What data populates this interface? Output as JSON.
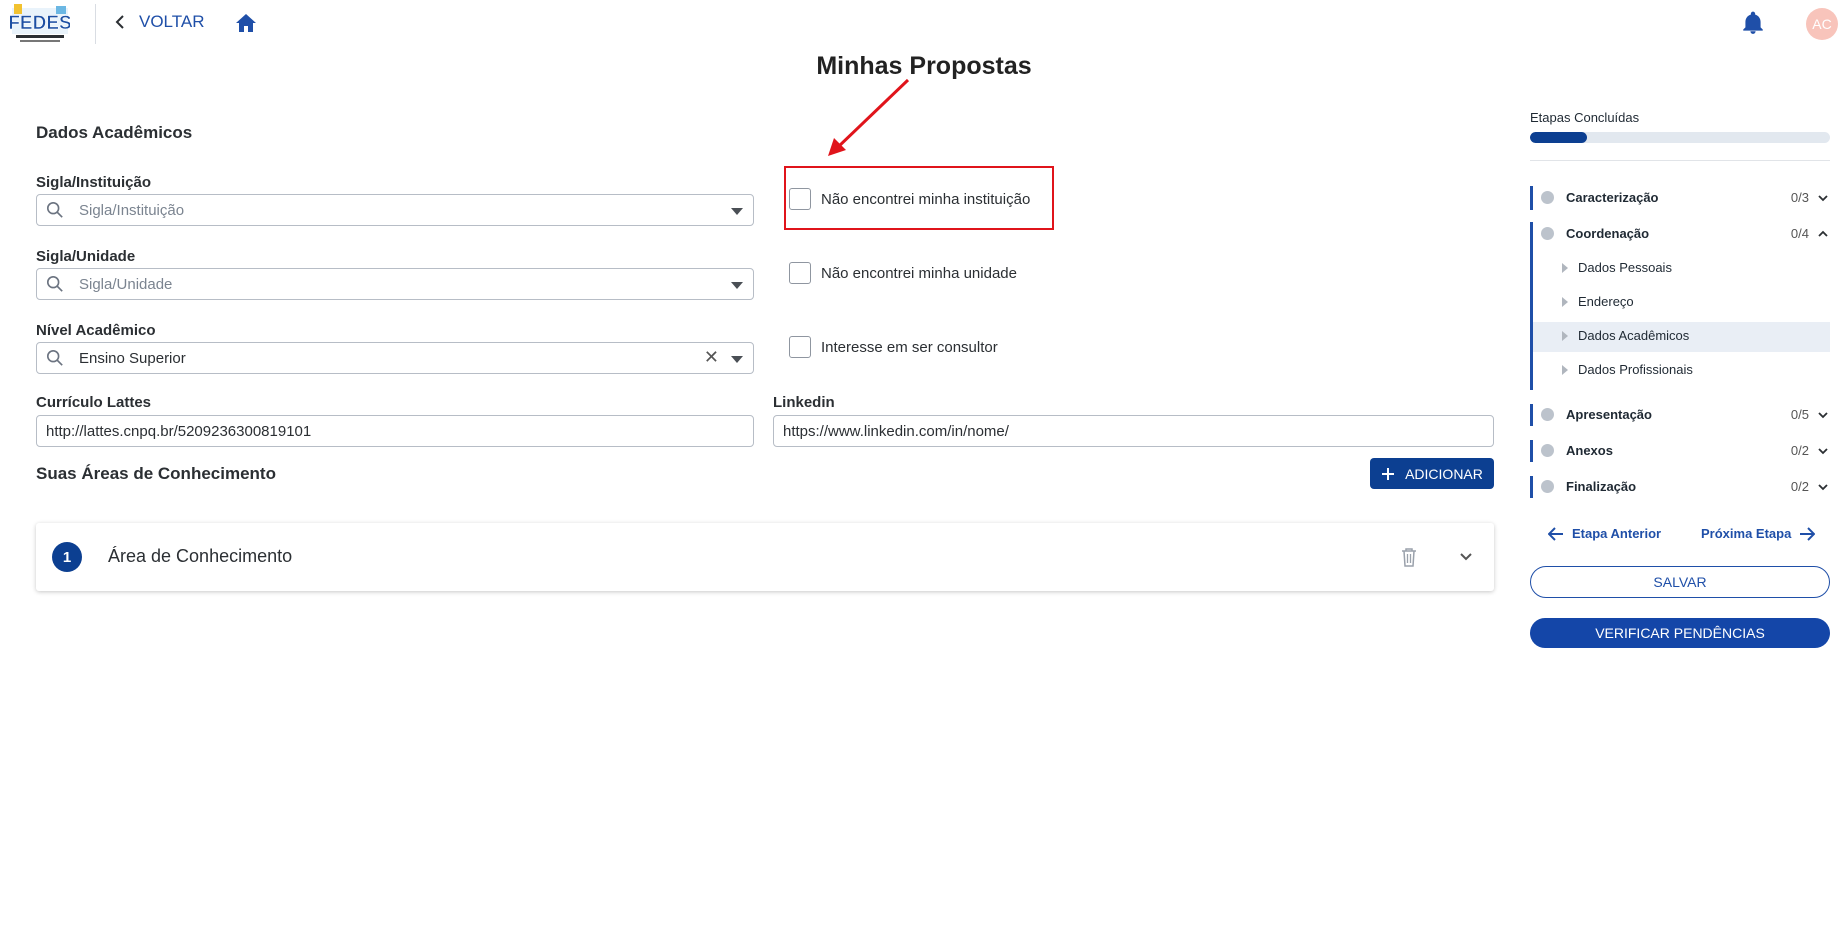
{
  "header": {
    "logo_text": "FEDES",
    "back_label": "VOLTAR",
    "avatar_initials": "AC"
  },
  "page": {
    "title": "Minhas Propostas"
  },
  "form": {
    "section_title": "Dados Acadêmicos",
    "institution": {
      "label": "Sigla/Instituição",
      "placeholder": "Sigla/Instituição"
    },
    "unit": {
      "label": "Sigla/Unidade",
      "placeholder": "Sigla/Unidade"
    },
    "level": {
      "label": "Nível Acadêmico",
      "value": "Ensino Superior"
    },
    "checkbox_institution": "Não encontrei minha instituição",
    "checkbox_unit": "Não encontrei minha unidade",
    "checkbox_consultant": "Interesse em ser consultor",
    "lattes": {
      "label": "Currículo Lattes",
      "value": "http://lattes.cnpq.br/5209236300819101"
    },
    "linkedin": {
      "label": "Linkedin",
      "value": "https://www.linkedin.com/in/nome/"
    },
    "areas_title": "Suas Áreas de Conhecimento",
    "add_label": "ADICIONAR",
    "area_card": {
      "number": "1",
      "title": "Área de Conhecimento"
    }
  },
  "sidebar": {
    "progress_label": "Etapas Concluídas",
    "progress_fraction": 0.19,
    "sections": [
      {
        "label": "Caracterização",
        "count": "0/3"
      },
      {
        "label": "Coordenação",
        "count": "0/4"
      },
      {
        "label": "Apresentação",
        "count": "0/5"
      },
      {
        "label": "Anexos",
        "count": "0/2"
      },
      {
        "label": "Finalização",
        "count": "0/2"
      }
    ],
    "subitems": [
      "Dados Pessoais",
      "Endereço",
      "Dados Acadêmicos",
      "Dados Profissionais"
    ],
    "prev_label": "Etapa Anterior",
    "next_label": "Próxima Etapa",
    "save_label": "SALVAR",
    "verify_label": "VERIFICAR PENDÊNCIAS"
  },
  "colors": {
    "primary": "#0c3f91",
    "highlight_box": "#e0141b",
    "avatar": "#f8c4bb"
  }
}
